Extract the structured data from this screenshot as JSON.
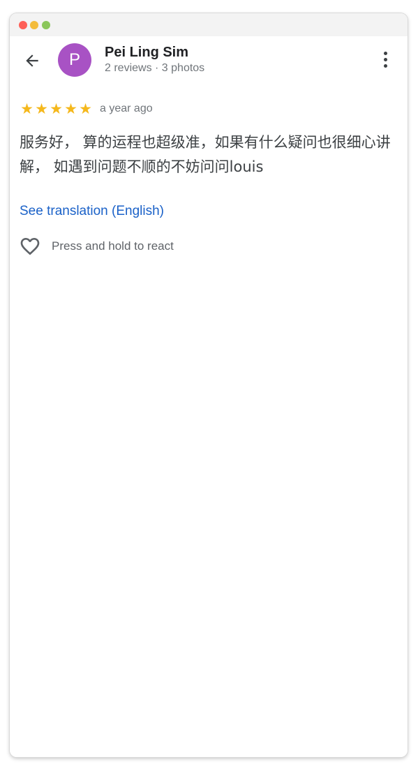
{
  "header": {
    "back_icon": "arrow-left-icon",
    "avatar_letter": "P",
    "avatar_color": "#a852c4",
    "user_name": "Pei Ling Sim",
    "user_meta": "2 reviews · 3 photos",
    "more_icon": "more-vertical-icon"
  },
  "review": {
    "rating": 5,
    "max_rating": 5,
    "star_color": "#f5b81c",
    "date": "a year ago",
    "text": "服务好， 算的运程也超级准，如果有什么疑问也很细心讲解， 如遇到问题不顺的不妨问问louis",
    "translate_link": "See translation (English)"
  },
  "reactions": {
    "heart_icon": "heart-outline-icon",
    "label": "Press and hold to react"
  },
  "colors": {
    "link": "#1a61c8",
    "secondary_text": "#70757a"
  }
}
